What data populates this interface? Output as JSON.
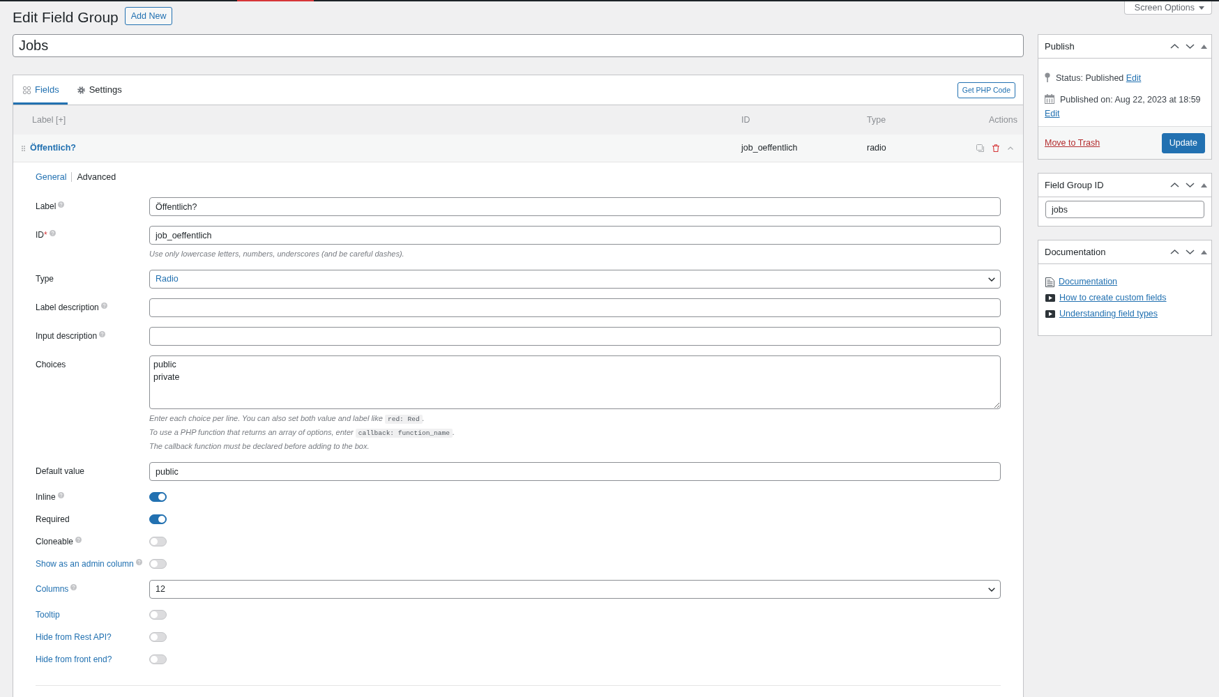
{
  "header": {
    "title": "Edit Field Group",
    "add_new": "Add New",
    "screen_options": "Screen Options"
  },
  "title_field": {
    "value": "Jobs"
  },
  "tabs": [
    {
      "label": "Fields",
      "selected": true
    },
    {
      "label": "Settings",
      "selected": false
    }
  ],
  "get_php_code": "Get PHP Code",
  "table": {
    "columns": [
      "Label [+]",
      "ID",
      "Type",
      "Actions"
    ],
    "rows": [
      {
        "label": "Öffentlich?",
        "id": "job_oeffentlich",
        "type": "radio",
        "expanded": true
      }
    ]
  },
  "field_settings": {
    "subtabs": [
      {
        "label": "General",
        "selected": true
      },
      {
        "label": "Advanced",
        "selected": false
      }
    ],
    "rows": [
      {
        "kind": "text",
        "label": "Label",
        "help": true,
        "link": false,
        "value": "Öffentlich?"
      },
      {
        "kind": "text",
        "label": "ID",
        "required_mark": "*",
        "help": true,
        "link": false,
        "value": "job_oeffentlich",
        "hints": [
          {
            "text": "Use only lowercase letters, numbers, underscores (and be careful dashes)."
          }
        ]
      },
      {
        "kind": "select",
        "label": "Type",
        "help": false,
        "link": false,
        "value": "Radio",
        "accent": true
      },
      {
        "kind": "text",
        "label": "Label description",
        "help": true,
        "link": false
      },
      {
        "kind": "text",
        "label": "Input description",
        "help": true,
        "link": false
      },
      {
        "kind": "textarea",
        "label": "Choices",
        "help": false,
        "link": false,
        "lines": [
          "public",
          "private"
        ],
        "hints": [
          {
            "text": "Enter each choice per line. You can also set both value and label like",
            "code": "red: Red",
            "after": "."
          },
          {
            "text": "To use a PHP function that returns an array of options, enter",
            "code": "callback: function_name",
            "after": "."
          },
          {
            "text": "The callback function must be declared before adding to the box."
          }
        ]
      },
      {
        "kind": "text",
        "label": "Default value",
        "help": false,
        "link": false,
        "value": "public"
      },
      {
        "kind": "toggle",
        "label": "Inline",
        "help": true,
        "link": false,
        "on": true
      },
      {
        "kind": "toggle",
        "label": "Required",
        "help": false,
        "link": false,
        "on": true
      },
      {
        "kind": "toggle",
        "label": "Cloneable",
        "help": true,
        "link": false,
        "on": false
      },
      {
        "kind": "toggle",
        "label": "Show as an admin column",
        "help": true,
        "link": true,
        "on": false
      },
      {
        "kind": "select",
        "label": "Columns",
        "help": true,
        "link": true,
        "value": "12",
        "accent": false
      },
      {
        "kind": "toggle",
        "label": "Tooltip",
        "help": false,
        "link": true,
        "on": false
      },
      {
        "kind": "toggle",
        "label": "Hide from Rest API?",
        "help": false,
        "link": true,
        "on": false
      },
      {
        "kind": "toggle",
        "label": "Hide from front end?",
        "help": false,
        "link": true,
        "on": false
      }
    ]
  },
  "publish": {
    "title": "Publish",
    "status": "Status: Published",
    "status_edit": "Edit",
    "date": "Published on: Aug 22, 2023 at 18:59",
    "date_edit": "Edit",
    "trash": "Move to Trash",
    "update": "Update"
  },
  "field_group_id": {
    "title": "Field Group ID",
    "value": "jobs"
  },
  "documentation": {
    "title": "Documentation",
    "links": [
      {
        "kind": "doc",
        "label": "Documentation"
      },
      {
        "kind": "video",
        "label": "How to create custom fields"
      },
      {
        "kind": "video",
        "label": "Understanding field types"
      }
    ]
  }
}
